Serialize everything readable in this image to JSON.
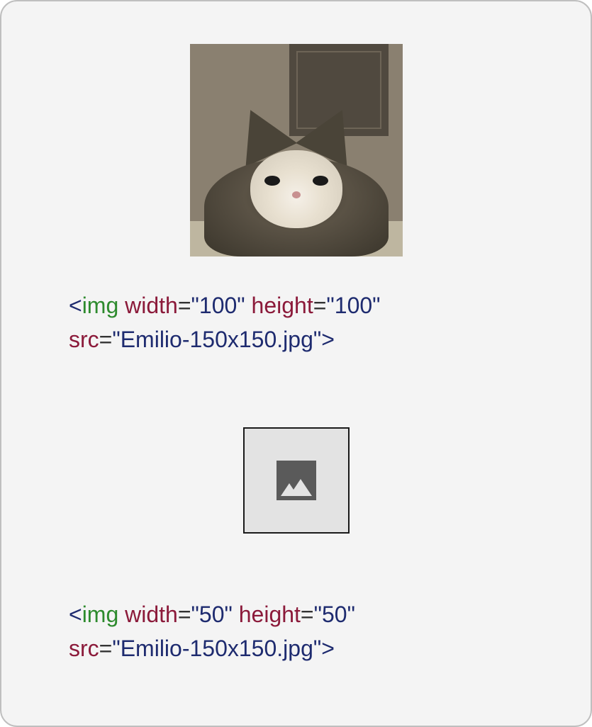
{
  "examples": [
    {
      "image_kind": "cat-photo",
      "code": {
        "tag": "img",
        "attrs": [
          {
            "name": "width",
            "value": "\"100\""
          },
          {
            "name": "height",
            "value": "\"100\""
          }
        ],
        "attrs_line2": [
          {
            "name": "src",
            "value": "\"Emilio-150x150.jpg\""
          }
        ]
      }
    },
    {
      "image_kind": "placeholder",
      "code": {
        "tag": "img",
        "attrs": [
          {
            "name": "width",
            "value": "\"50\""
          },
          {
            "name": "height",
            "value": "\"50\""
          }
        ],
        "attrs_line2": [
          {
            "name": "src",
            "value": "\"Emilio-150x150.jpg\""
          }
        ]
      }
    }
  ],
  "tokens": {
    "lt": "<",
    "gt": ">",
    "eq": "="
  }
}
